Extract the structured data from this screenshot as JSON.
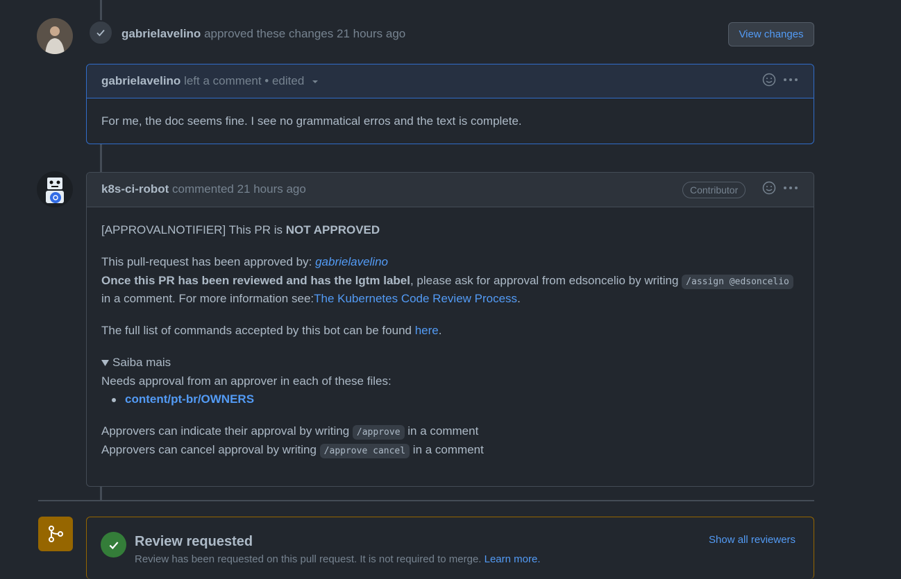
{
  "review": {
    "author": "gabrielavelino",
    "action": "approved these changes",
    "time": "21 hours ago",
    "view_changes_label": "View changes"
  },
  "comment1": {
    "author": "gabrielavelino",
    "action": "left a comment",
    "edited": "• edited",
    "body": "For me, the doc seems fine. I see no grammatical erros and the text is complete."
  },
  "comment2": {
    "author": "k8s-ci-robot",
    "action": "commented",
    "time": "21 hours ago",
    "badge": "Contributor",
    "p1_prefix": "[APPROVALNOTIFIER] This PR is ",
    "p1_bold": "NOT APPROVED",
    "p2_prefix": "This pull-request has been approved by: ",
    "p2_link": "gabrielavelino",
    "p3_bold": "Once this PR has been reviewed and has the lgtm label",
    "p3_mid": ", please ask for approval from edsoncelio by writing ",
    "p3_code": "/assign @edsoncelio",
    "p4_prefix": "in a comment. For more information see:",
    "p4_link": "The Kubernetes Code Review Process",
    "p4_suffix": ".",
    "p5_prefix": "The full list of commands accepted by this bot can be found ",
    "p5_link": "here",
    "p5_suffix": ".",
    "details_summary": "Saiba mais",
    "needs_approval": "Needs approval from an approver in each of these files:",
    "file_link": "content/pt-br/OWNERS",
    "approve_prefix": "Approvers can indicate their approval by writing ",
    "approve_code": "/approve",
    "approve_suffix": " in a comment",
    "cancel_prefix": "Approvers can cancel approval by writing ",
    "cancel_code": "/approve cancel",
    "cancel_suffix": " in a comment"
  },
  "review_requested": {
    "title": "Review requested",
    "desc": "Review has been requested on this pull request. It is not required to merge.",
    "learn_more": "Learn more.",
    "show_all": "Show all reviewers"
  }
}
